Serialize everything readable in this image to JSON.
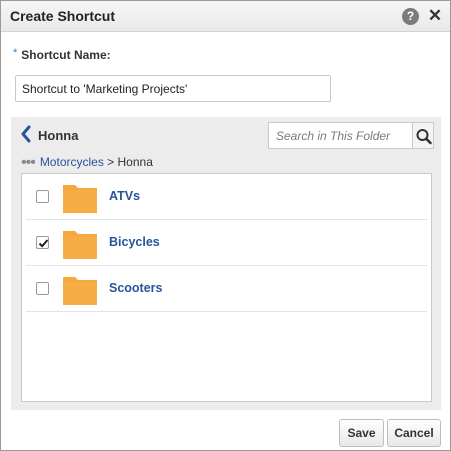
{
  "dialog": {
    "title": "Create Shortcut",
    "help_glyph": "?",
    "close_glyph": "✕"
  },
  "form": {
    "required_marker": "*",
    "name_label": "Shortcut Name:",
    "name_value": "Shortcut to 'Marketing Projects'"
  },
  "browser": {
    "current_folder": "Honna",
    "search_placeholder": "Search in This Folder",
    "breadcrumb": {
      "overflow": "•••",
      "parent": "Motorcycles",
      "separator": " > ",
      "current": "Honna"
    },
    "items": [
      {
        "label": "ATVs",
        "checked": false,
        "icon": "folder-icon"
      },
      {
        "label": "Bicycles",
        "checked": true,
        "icon": "folder-icon"
      },
      {
        "label": "Scooters",
        "checked": false,
        "icon": "folder-icon"
      }
    ]
  },
  "footer": {
    "save_label": "Save",
    "cancel_label": "Cancel"
  },
  "colors": {
    "link": "#26559c",
    "folder": "#f5a83c",
    "panel_bg": "#ececec"
  }
}
